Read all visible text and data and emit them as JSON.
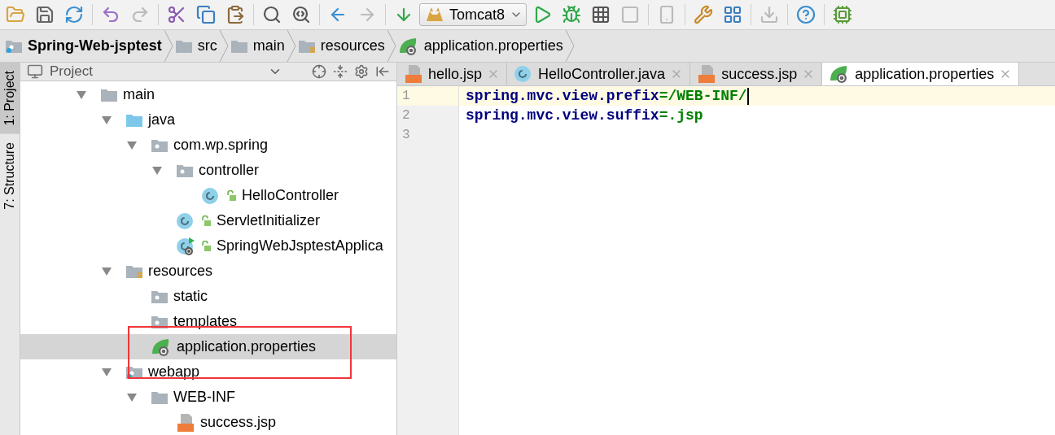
{
  "toolbar": {
    "run_config": "Tomcat8"
  },
  "breadcrumbs": [
    {
      "label": "Spring-Web-jsptest",
      "kind": "project"
    },
    {
      "label": "src",
      "kind": "folder"
    },
    {
      "label": "main",
      "kind": "folder"
    },
    {
      "label": "resources",
      "kind": "resources"
    },
    {
      "label": "application.properties",
      "kind": "spring"
    }
  ],
  "side_tabs": [
    {
      "label": "1: Project",
      "selected": true
    },
    {
      "label": "7: Structure",
      "selected": false
    }
  ],
  "project_panel": {
    "title": "Project",
    "tree": [
      {
        "label": "main",
        "kind": "folder",
        "expanded": true,
        "selected": false,
        "children": [
          {
            "label": "java",
            "kind": "source",
            "expanded": true,
            "selected": false,
            "children": [
              {
                "label": "com.wp.spring",
                "kind": "package",
                "expanded": true,
                "selected": false,
                "children": [
                  {
                    "label": "controller",
                    "kind": "package",
                    "expanded": true,
                    "selected": false,
                    "children": [
                      {
                        "label": "HelloController",
                        "kind": "class",
                        "selected": false
                      }
                    ]
                  },
                  {
                    "label": "ServletInitializer",
                    "kind": "class",
                    "selected": false
                  },
                  {
                    "label": "SpringWebJsptestApplica",
                    "kind": "app",
                    "selected": false
                  }
                ]
              }
            ]
          },
          {
            "label": "resources",
            "kind": "resources",
            "expanded": true,
            "selected": false,
            "children": [
              {
                "label": "static",
                "kind": "package",
                "selected": false
              },
              {
                "label": "templates",
                "kind": "package",
                "selected": false
              },
              {
                "label": "application.properties",
                "kind": "spring",
                "selected": true
              }
            ]
          },
          {
            "label": "webapp",
            "kind": "webapp",
            "expanded": true,
            "selected": false,
            "children": [
              {
                "label": "WEB-INF",
                "kind": "folder",
                "expanded": true,
                "selected": false,
                "children": [
                  {
                    "label": "success.jsp",
                    "kind": "jsp",
                    "selected": false
                  }
                ]
              }
            ]
          }
        ]
      }
    ]
  },
  "editor_tabs": [
    {
      "label": "hello.jsp",
      "kind": "jsp",
      "selected": false
    },
    {
      "label": "HelloController.java",
      "kind": "class",
      "selected": false
    },
    {
      "label": "success.jsp",
      "kind": "jsp",
      "selected": false
    },
    {
      "label": "application.properties",
      "kind": "spring",
      "selected": true
    }
  ],
  "editor": {
    "lines": [
      {
        "number": "1",
        "key": "spring.mvc.view.prefix",
        "value": "=/WEB-INF/",
        "current": true
      },
      {
        "number": "2",
        "key": "spring.mvc.view.suffix",
        "value": "=.jsp",
        "current": false
      },
      {
        "number": "3",
        "current": false
      }
    ]
  }
}
